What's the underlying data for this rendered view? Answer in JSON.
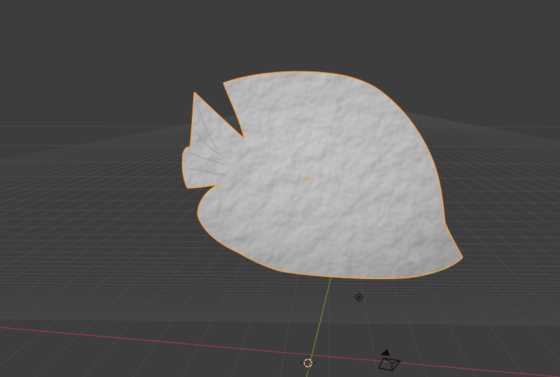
{
  "viewport": {
    "mode": "3D Viewport",
    "background_color": "#3d3d3d",
    "grid_color": "#4a4a4a",
    "x_axis_color": "#a23a4d",
    "y_axis_color": "#6e8f24"
  },
  "scene": {
    "selected_object": {
      "kind": "fish sculpt mesh",
      "surface_color": "#c8c8c8",
      "selection_outline_color": "#f29a37"
    },
    "light": {
      "icon": "light-icon"
    },
    "camera": {
      "icon": "camera-icon"
    },
    "cursor_3d": {
      "icon": "3d-cursor-icon"
    }
  }
}
